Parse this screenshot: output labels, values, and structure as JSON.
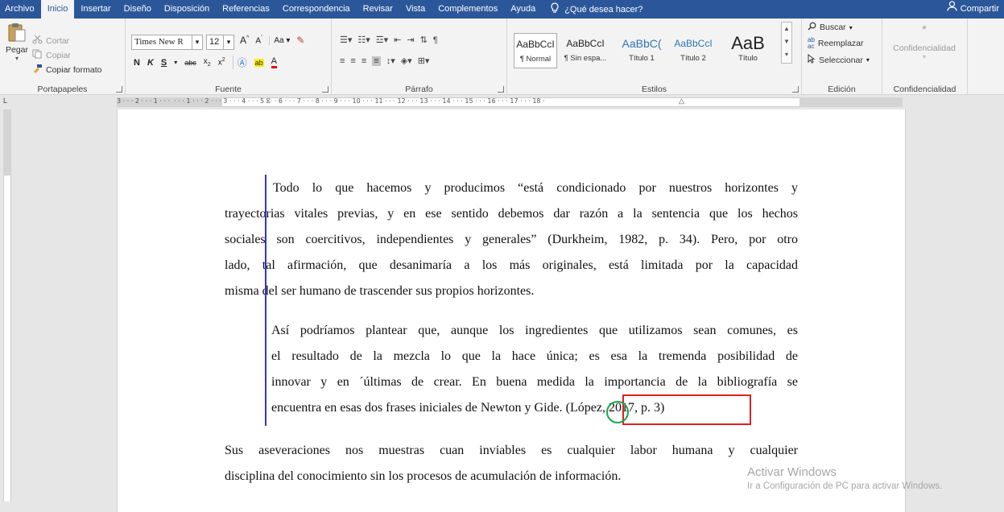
{
  "tabs": {
    "archivo": "Archivo",
    "inicio": "Inicio",
    "insertar": "Insertar",
    "diseno": "Diseño",
    "disposicion": "Disposición",
    "referencias": "Referencias",
    "correspondencia": "Correspondencia",
    "revisar": "Revisar",
    "vista": "Vista",
    "complementos": "Complementos",
    "ayuda": "Ayuda",
    "tellme": "¿Qué desea hacer?",
    "share": "Compartir"
  },
  "clipboard": {
    "paste": "Pegar",
    "cut": "Cortar",
    "copy": "Copiar",
    "format_painter": "Copiar formato",
    "label": "Portapapeles"
  },
  "font": {
    "name": "Times New R",
    "size": "12",
    "label": "Fuente"
  },
  "paragraph": {
    "label": "Párrafo"
  },
  "styles": {
    "label": "Estilos",
    "items": [
      {
        "sample": "AaBbCcI",
        "name": "¶ Normal"
      },
      {
        "sample": "AaBbCcI",
        "name": "¶ Sin espa..."
      },
      {
        "sample": "AaBbC(",
        "name": "Título 1"
      },
      {
        "sample": "AaBbCcI",
        "name": "Título 2"
      },
      {
        "sample": "AaB",
        "name": "Título"
      }
    ]
  },
  "editing": {
    "find": "Buscar",
    "replace": "Reemplazar",
    "select": "Seleccionar",
    "label": "Edición"
  },
  "confidentiality": {
    "button": "Confidencialidad",
    "label": "Confidencialidad"
  },
  "ruler": {
    "numbers": "3 · · · 2 · · · 1 · · ·  · · · 1 · · · 2 · · · 3 · · · 4 · · · 5 · · · 6 · · · 7 · · · 8 · · · 9 · · · 10 · · · 11 · · · 12 · · · 13 · · · 14 · · · 15 · · · 16 · · · 17 · · · 18 ·"
  },
  "document": {
    "para1": [
      "Todo lo que hacemos y producimos “está condicionado por nuestros horizontes y",
      "trayectorias vitales previas, y en ese sentido debemos dar razón a la sentencia que los hechos",
      "sociales son coercitivos, independientes y generales” (Durkheim, 1982, p. 34). Pero, por otro",
      "lado, tal afirmación, que desanimaría a los más originales, está limitada por la capacidad",
      "misma del ser humano de trascender sus propios horizontes."
    ],
    "quote": [
      "Así podríamos plantear que, aunque los ingredientes que utilizamos sean comunes, es",
      "el resultado de la mezcla lo que la hace única; es esa la tremenda posibilidad de",
      "innovar y en ´últimas de crear. En buena medida la importancia de la bibliografía se",
      "encuentra en esas dos frases iniciales de Newton y Gide. (López, 2017, p. 3)"
    ],
    "para2": [
      "Sus aseveraciones nos muestras cuan inviables es cualquier labor humana y cualquier",
      "disciplina del conocimiento sin los procesos de acumulación de información."
    ]
  },
  "watermark": {
    "title": "Activar Windows",
    "subtitle": "Ir a Configuración de PC para activar Windows."
  },
  "colors": {
    "ribbon_blue": "#2b579a",
    "change_bar": "#3434c8",
    "highlight_box": "#e02020",
    "highlight_circle": "#17a64a"
  }
}
